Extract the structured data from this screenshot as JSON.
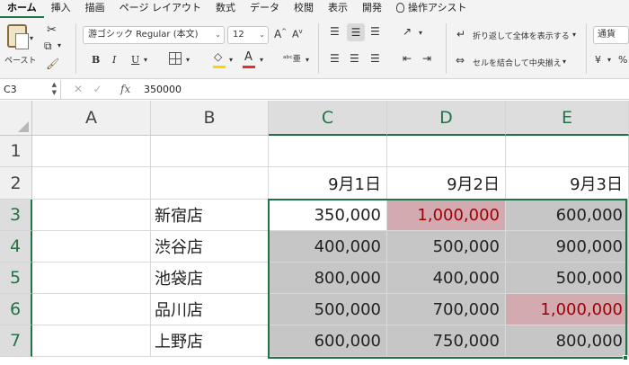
{
  "tabs": [
    "ホーム",
    "挿入",
    "描画",
    "ページ レイアウト",
    "数式",
    "データ",
    "校閲",
    "表示",
    "開発",
    "操作アシスト"
  ],
  "active_tab": "ホーム",
  "ribbon": {
    "paste_label": "ペースト",
    "font_name": "游ゴシック Regular (本文)",
    "font_size": "12",
    "bold": "B",
    "italic": "I",
    "underline": "U",
    "wrap_text": "折り返して全体を表示する",
    "merge_center": "セルを結合して中央揃え",
    "number_format": "通貨",
    "font_color": "#e03030",
    "fill_color": "#ffd500"
  },
  "formula_bar": {
    "name_box": "C3",
    "fx": "fx",
    "value": "350000"
  },
  "columns": [
    "A",
    "B",
    "C",
    "D",
    "E"
  ],
  "rows": [
    "1",
    "2",
    "3",
    "4",
    "5",
    "6",
    "7"
  ],
  "cells": {
    "c2": "9月1日",
    "d2": "9月2日",
    "e2": "9月3日",
    "b3": "新宿店",
    "c3": "350,000",
    "d3": "1,000,000",
    "e3": "600,000",
    "b4": "渋谷店",
    "c4": "400,000",
    "d4": "500,000",
    "e4": "900,000",
    "b5": "池袋店",
    "c5": "800,000",
    "d5": "400,000",
    "e5": "500,000",
    "b6": "品川店",
    "c6": "500,000",
    "d6": "700,000",
    "e6": "1,000,000",
    "b7": "上野店",
    "c7": "600,000",
    "d7": "750,000",
    "e7": "800,000"
  },
  "colors": {
    "accent": "#217346",
    "selection_fill": "#c6c6c6",
    "highlight_fill": "#d3aab0",
    "highlight_text": "#9c0006"
  }
}
